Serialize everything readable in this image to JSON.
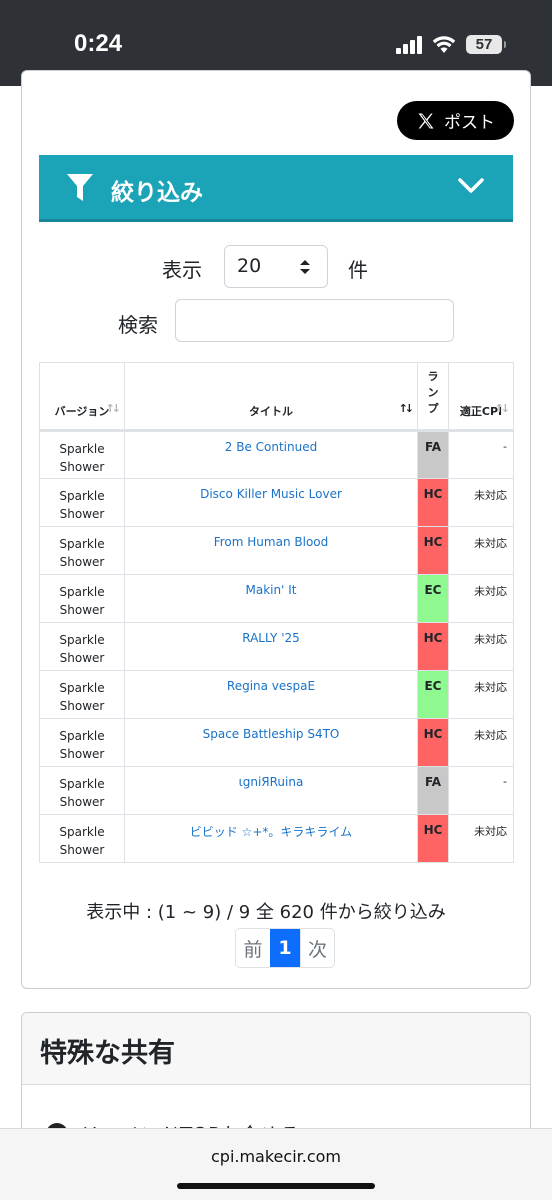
{
  "status": {
    "time": "0:24",
    "battery": "57"
  },
  "post_button": {
    "label": "ポスト"
  },
  "filter": {
    "label": "絞り込み"
  },
  "controls": {
    "show_label": "表示",
    "page_size": "20",
    "count_unit": "件",
    "search_label": "検索",
    "search_value": ""
  },
  "table": {
    "headers": {
      "version": "バージョン",
      "title": "タイトル",
      "lamp": "ランプ",
      "cpi": "適正CPI"
    },
    "rows": [
      {
        "version": [
          "Sparkle",
          "Shower"
        ],
        "title": "2 Be Continued",
        "lamp": "FA",
        "cpi": "-"
      },
      {
        "version": [
          "Sparkle",
          "Shower"
        ],
        "title": "Disco Killer Music Lover",
        "lamp": "HC",
        "cpi": "未対応"
      },
      {
        "version": [
          "Sparkle",
          "Shower"
        ],
        "title": "From Human Blood",
        "lamp": "HC",
        "cpi": "未対応"
      },
      {
        "version": [
          "Sparkle",
          "Shower"
        ],
        "title": "Makin' It",
        "lamp": "EC",
        "cpi": "未対応"
      },
      {
        "version": [
          "Sparkle",
          "Shower"
        ],
        "title": "RALLY '25",
        "lamp": "HC",
        "cpi": "未対応"
      },
      {
        "version": [
          "Sparkle",
          "Shower"
        ],
        "title": "Regina vespaE",
        "lamp": "EC",
        "cpi": "未対応"
      },
      {
        "version": [
          "Sparkle",
          "Shower"
        ],
        "title": "Space Battleship S4TO",
        "lamp": "HC",
        "cpi": "未対応"
      },
      {
        "version": [
          "Sparkle",
          "Shower"
        ],
        "title": "ɩgniЯRuina",
        "lamp": "FA",
        "cpi": "-"
      },
      {
        "version": [
          "Sparkle",
          "Shower"
        ],
        "title": "ビビッド ☆+*。キラキライム",
        "lamp": "HC",
        "cpi": "未対応"
      }
    ]
  },
  "info": {
    "text": "表示中 : (1 ~ 9) / 9 全 620 件から絞り込み"
  },
  "pager": {
    "prev": "前",
    "current": "1",
    "next": "次"
  },
  "share": {
    "heading": "特殊な共有",
    "item": "リコメンドTOPを含める"
  },
  "url": "cpi.makecir.com",
  "colors": {
    "filter_bar": "#1ba3b8",
    "link": "#1a73c9",
    "FA": "#c8c8c8",
    "HC": "#ff6464",
    "EC": "#90f890",
    "pager_active": "#0d6efd"
  }
}
